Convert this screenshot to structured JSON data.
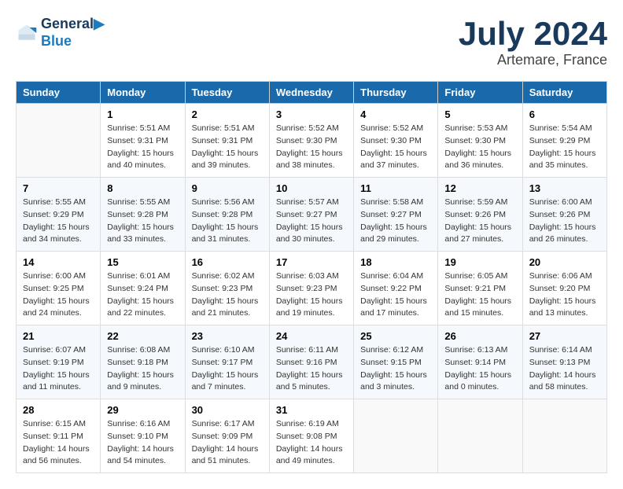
{
  "logo": {
    "line1": "General",
    "line2": "Blue"
  },
  "title": "July 2024",
  "location": "Artemare, France",
  "header_days": [
    "Sunday",
    "Monday",
    "Tuesday",
    "Wednesday",
    "Thursday",
    "Friday",
    "Saturday"
  ],
  "weeks": [
    [
      {
        "day": "",
        "info": ""
      },
      {
        "day": "1",
        "info": "Sunrise: 5:51 AM\nSunset: 9:31 PM\nDaylight: 15 hours\nand 40 minutes."
      },
      {
        "day": "2",
        "info": "Sunrise: 5:51 AM\nSunset: 9:31 PM\nDaylight: 15 hours\nand 39 minutes."
      },
      {
        "day": "3",
        "info": "Sunrise: 5:52 AM\nSunset: 9:30 PM\nDaylight: 15 hours\nand 38 minutes."
      },
      {
        "day": "4",
        "info": "Sunrise: 5:52 AM\nSunset: 9:30 PM\nDaylight: 15 hours\nand 37 minutes."
      },
      {
        "day": "5",
        "info": "Sunrise: 5:53 AM\nSunset: 9:30 PM\nDaylight: 15 hours\nand 36 minutes."
      },
      {
        "day": "6",
        "info": "Sunrise: 5:54 AM\nSunset: 9:29 PM\nDaylight: 15 hours\nand 35 minutes."
      }
    ],
    [
      {
        "day": "7",
        "info": "Sunrise: 5:55 AM\nSunset: 9:29 PM\nDaylight: 15 hours\nand 34 minutes."
      },
      {
        "day": "8",
        "info": "Sunrise: 5:55 AM\nSunset: 9:28 PM\nDaylight: 15 hours\nand 33 minutes."
      },
      {
        "day": "9",
        "info": "Sunrise: 5:56 AM\nSunset: 9:28 PM\nDaylight: 15 hours\nand 31 minutes."
      },
      {
        "day": "10",
        "info": "Sunrise: 5:57 AM\nSunset: 9:27 PM\nDaylight: 15 hours\nand 30 minutes."
      },
      {
        "day": "11",
        "info": "Sunrise: 5:58 AM\nSunset: 9:27 PM\nDaylight: 15 hours\nand 29 minutes."
      },
      {
        "day": "12",
        "info": "Sunrise: 5:59 AM\nSunset: 9:26 PM\nDaylight: 15 hours\nand 27 minutes."
      },
      {
        "day": "13",
        "info": "Sunrise: 6:00 AM\nSunset: 9:26 PM\nDaylight: 15 hours\nand 26 minutes."
      }
    ],
    [
      {
        "day": "14",
        "info": "Sunrise: 6:00 AM\nSunset: 9:25 PM\nDaylight: 15 hours\nand 24 minutes."
      },
      {
        "day": "15",
        "info": "Sunrise: 6:01 AM\nSunset: 9:24 PM\nDaylight: 15 hours\nand 22 minutes."
      },
      {
        "day": "16",
        "info": "Sunrise: 6:02 AM\nSunset: 9:23 PM\nDaylight: 15 hours\nand 21 minutes."
      },
      {
        "day": "17",
        "info": "Sunrise: 6:03 AM\nSunset: 9:23 PM\nDaylight: 15 hours\nand 19 minutes."
      },
      {
        "day": "18",
        "info": "Sunrise: 6:04 AM\nSunset: 9:22 PM\nDaylight: 15 hours\nand 17 minutes."
      },
      {
        "day": "19",
        "info": "Sunrise: 6:05 AM\nSunset: 9:21 PM\nDaylight: 15 hours\nand 15 minutes."
      },
      {
        "day": "20",
        "info": "Sunrise: 6:06 AM\nSunset: 9:20 PM\nDaylight: 15 hours\nand 13 minutes."
      }
    ],
    [
      {
        "day": "21",
        "info": "Sunrise: 6:07 AM\nSunset: 9:19 PM\nDaylight: 15 hours\nand 11 minutes."
      },
      {
        "day": "22",
        "info": "Sunrise: 6:08 AM\nSunset: 9:18 PM\nDaylight: 15 hours\nand 9 minutes."
      },
      {
        "day": "23",
        "info": "Sunrise: 6:10 AM\nSunset: 9:17 PM\nDaylight: 15 hours\nand 7 minutes."
      },
      {
        "day": "24",
        "info": "Sunrise: 6:11 AM\nSunset: 9:16 PM\nDaylight: 15 hours\nand 5 minutes."
      },
      {
        "day": "25",
        "info": "Sunrise: 6:12 AM\nSunset: 9:15 PM\nDaylight: 15 hours\nand 3 minutes."
      },
      {
        "day": "26",
        "info": "Sunrise: 6:13 AM\nSunset: 9:14 PM\nDaylight: 15 hours\nand 0 minutes."
      },
      {
        "day": "27",
        "info": "Sunrise: 6:14 AM\nSunset: 9:13 PM\nDaylight: 14 hours\nand 58 minutes."
      }
    ],
    [
      {
        "day": "28",
        "info": "Sunrise: 6:15 AM\nSunset: 9:11 PM\nDaylight: 14 hours\nand 56 minutes."
      },
      {
        "day": "29",
        "info": "Sunrise: 6:16 AM\nSunset: 9:10 PM\nDaylight: 14 hours\nand 54 minutes."
      },
      {
        "day": "30",
        "info": "Sunrise: 6:17 AM\nSunset: 9:09 PM\nDaylight: 14 hours\nand 51 minutes."
      },
      {
        "day": "31",
        "info": "Sunrise: 6:19 AM\nSunset: 9:08 PM\nDaylight: 14 hours\nand 49 minutes."
      },
      {
        "day": "",
        "info": ""
      },
      {
        "day": "",
        "info": ""
      },
      {
        "day": "",
        "info": ""
      }
    ]
  ]
}
